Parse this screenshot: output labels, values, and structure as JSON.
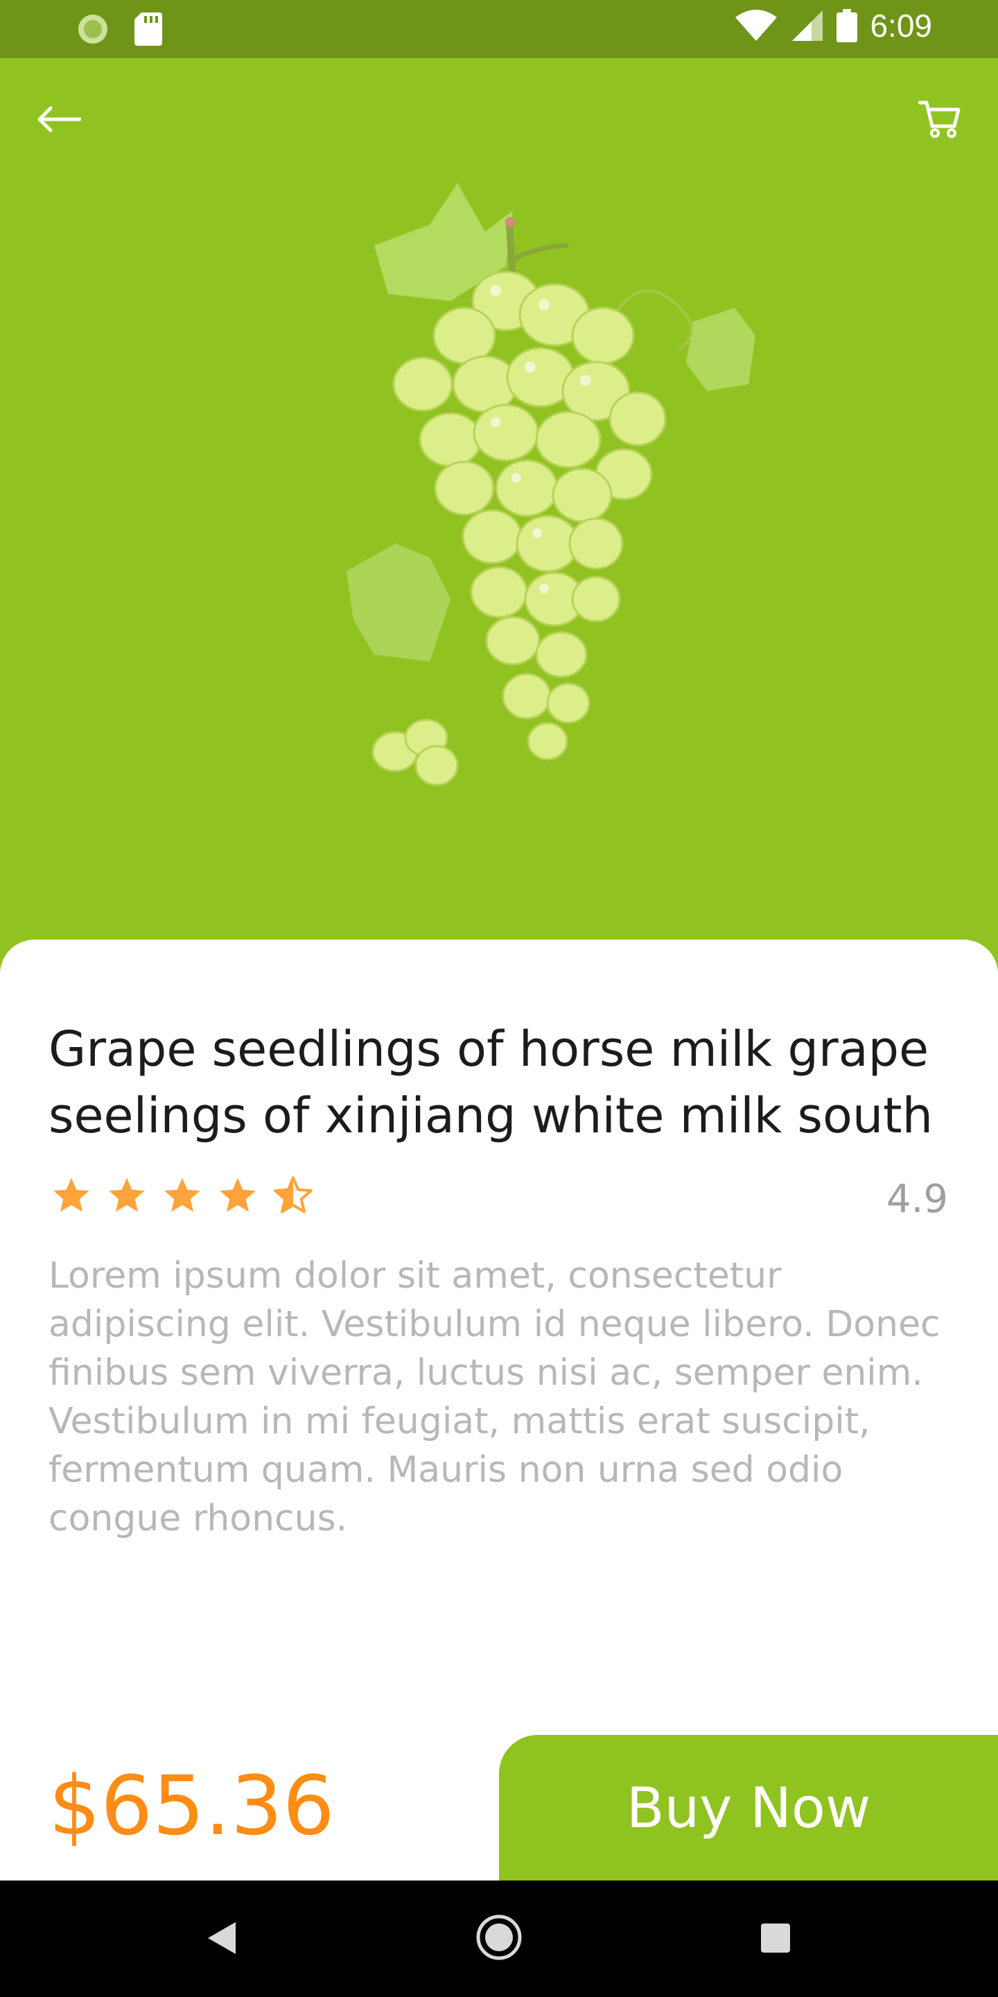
{
  "status_bar": {
    "time": "6:09"
  },
  "header": {
    "back_icon": "arrow-left-icon",
    "cart_icon": "shopping-cart-icon"
  },
  "product": {
    "title": "Grape seedlings of horse milk grape seelings of xinjiang white milk south",
    "rating": 4.5,
    "rating_text": "4.9",
    "description": "Lorem ipsum dolor sit amet, consectetur adipiscing elit. Vestibulum id neque libero. Donec finibus sem viverra, luctus nisi ac, semper enim. Vestibulum in mi feugiat, mattis erat suscipit, fermentum quam. Mauris non urna sed odio congue rhoncus.",
    "price": "$65.36",
    "image": "green-grapes"
  },
  "actions": {
    "buy_label": "Buy Now"
  },
  "colors": {
    "accent": "#90c322",
    "price": "#ff8c14",
    "star": "#ffa33a"
  }
}
